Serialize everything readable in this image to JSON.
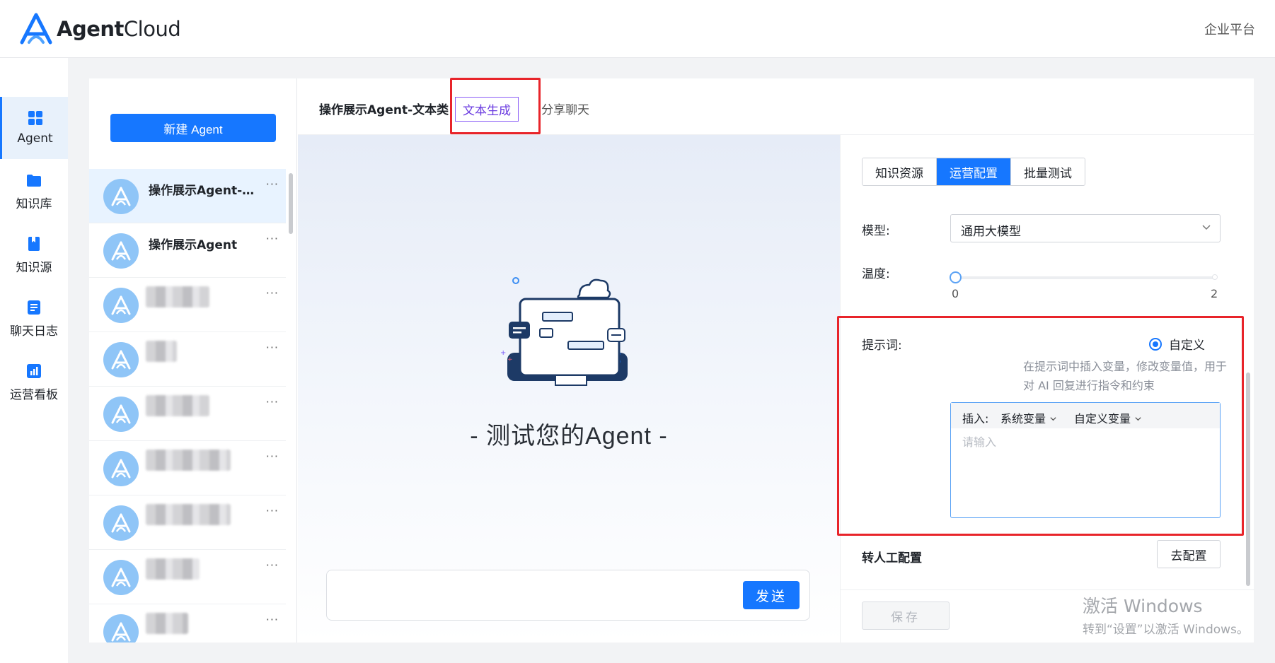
{
  "header": {
    "logo_bold": "Agent",
    "logo_light": "Cloud",
    "right_link": "企业平台"
  },
  "leftnav": {
    "items": [
      {
        "label": "Agent",
        "icon": "grid-icon"
      },
      {
        "label": "知识库",
        "icon": "folder-icon"
      },
      {
        "label": "知识源",
        "icon": "book-icon"
      },
      {
        "label": "聊天日志",
        "icon": "document-icon"
      },
      {
        "label": "运营看板",
        "icon": "bar-chart-icon"
      }
    ],
    "active": "Agent"
  },
  "agents": {
    "new_button": "新建 Agent",
    "items": [
      {
        "name": "操作展示Agent-文本类",
        "more": "···"
      },
      {
        "name": "操作展示Agent",
        "more": "···"
      },
      {
        "name": "",
        "more": "···"
      },
      {
        "name": "",
        "more": "···"
      },
      {
        "name": "",
        "more": "···"
      },
      {
        "name": "",
        "more": "···"
      },
      {
        "name": "",
        "more": "···"
      },
      {
        "name": "",
        "more": "···"
      },
      {
        "name": "",
        "more": "···"
      }
    ]
  },
  "tabs": {
    "agent_title": "操作展示Agent-文本类",
    "text_gen": "文本生成",
    "share_chat": "分享聊天"
  },
  "chat": {
    "heading": "- 测试您的Agent -",
    "input_placeholder": "",
    "send": "发送"
  },
  "config": {
    "segments": [
      "知识资源",
      "运营配置",
      "批量测试"
    ],
    "active_segment": "运营配置",
    "model_label": "模型:",
    "model_value": "通用大模型",
    "temperature_label": "温度:",
    "temperature_min": "0",
    "temperature_max": "2",
    "temperature_value": 0,
    "prompt_label": "提示词:",
    "prompt_mode": "自定义",
    "prompt_hint": "在提示词中插入变量，修改变量值，用于对 AI 回复进行指令和约束",
    "insert_label": "插入:",
    "system_var": "系统变量",
    "custom_var": "自定义变量",
    "prompt_placeholder": "请输入",
    "transfer_label": "转人工配置",
    "transfer_button": "去配置",
    "save_button": "保存"
  },
  "watermark": {
    "line1": "激活 Windows",
    "line2": "转到“设置”以激活 Windows。"
  },
  "colors": {
    "primary": "#1677ff",
    "highlight_red": "#e8242a",
    "tab_purple": "#8a5cf6",
    "avatar": "#8fc5f7"
  }
}
